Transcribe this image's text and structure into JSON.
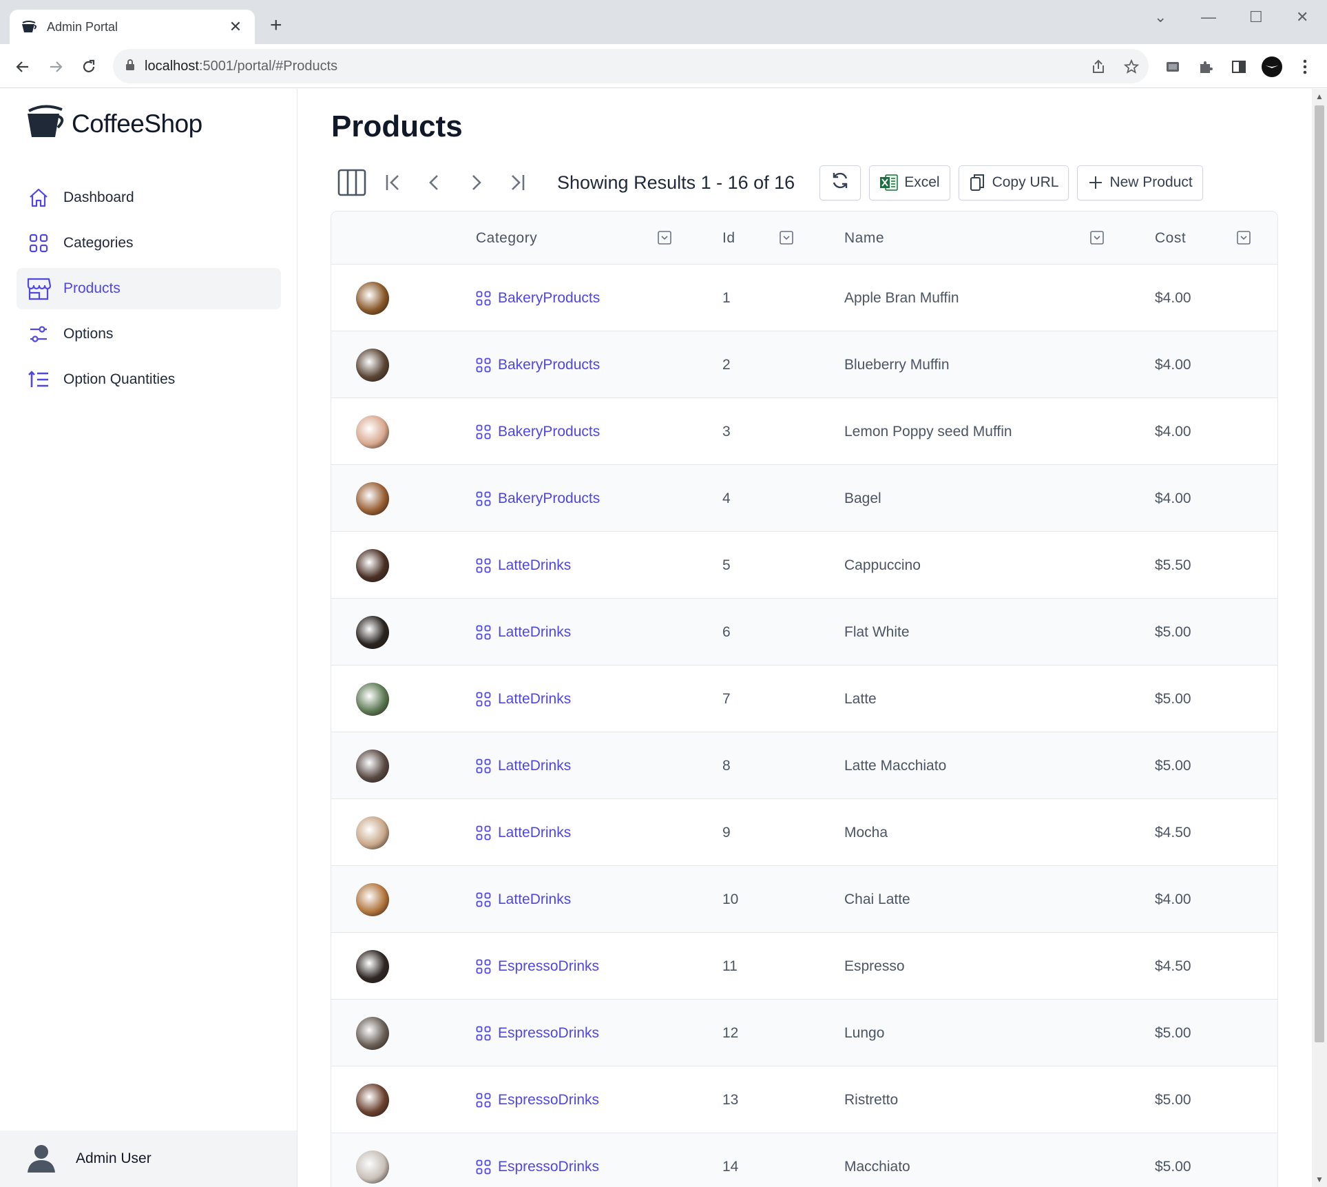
{
  "browser": {
    "tab_title": "Admin Portal",
    "url_host": "localhost",
    "url_path": ":5001/portal/#Products"
  },
  "app": {
    "brand": "CoffeeShop",
    "nav": [
      {
        "label": "Dashboard",
        "icon": "home-icon",
        "active": false
      },
      {
        "label": "Categories",
        "icon": "grid-icon",
        "active": false
      },
      {
        "label": "Products",
        "icon": "store-icon",
        "active": true
      },
      {
        "label": "Options",
        "icon": "sliders-icon",
        "active": false
      },
      {
        "label": "Option Quantities",
        "icon": "list-increase-icon",
        "active": false
      }
    ],
    "user": "Admin User"
  },
  "page": {
    "title": "Products",
    "results_text": "Showing Results 1 - 16 of 16",
    "buttons": {
      "excel": "Excel",
      "copy_url": "Copy URL",
      "new_product": "New Product"
    }
  },
  "table": {
    "columns": [
      "Category",
      "Id",
      "Name",
      "Cost"
    ],
    "rows": [
      {
        "category": "BakeryProducts",
        "id": "1",
        "name": "Apple Bran Muffin",
        "cost": "$4.00",
        "thumb": "#8a5a2b"
      },
      {
        "category": "BakeryProducts",
        "id": "2",
        "name": "Blueberry Muffin",
        "cost": "$4.00",
        "thumb": "#5b4636"
      },
      {
        "category": "BakeryProducts",
        "id": "3",
        "name": "Lemon Poppy seed Muffin",
        "cost": "$4.00",
        "thumb": "#d9a98f"
      },
      {
        "category": "BakeryProducts",
        "id": "4",
        "name": "Bagel",
        "cost": "$4.00",
        "thumb": "#9a6035"
      },
      {
        "category": "LatteDrinks",
        "id": "5",
        "name": "Cappuccino",
        "cost": "$5.50",
        "thumb": "#4a3026"
      },
      {
        "category": "LatteDrinks",
        "id": "6",
        "name": "Flat White",
        "cost": "$5.00",
        "thumb": "#2a2420"
      },
      {
        "category": "LatteDrinks",
        "id": "7",
        "name": "Latte",
        "cost": "$5.00",
        "thumb": "#5e7a55"
      },
      {
        "category": "LatteDrinks",
        "id": "8",
        "name": "Latte Macchiato",
        "cost": "$5.00",
        "thumb": "#5a4a44"
      },
      {
        "category": "LatteDrinks",
        "id": "9",
        "name": "Mocha",
        "cost": "$4.50",
        "thumb": "#c9a88a"
      },
      {
        "category": "LatteDrinks",
        "id": "10",
        "name": "Chai Latte",
        "cost": "$4.00",
        "thumb": "#b3773f"
      },
      {
        "category": "EspressoDrinks",
        "id": "11",
        "name": "Espresso",
        "cost": "$4.50",
        "thumb": "#2f2723"
      },
      {
        "category": "EspressoDrinks",
        "id": "12",
        "name": "Lungo",
        "cost": "$5.00",
        "thumb": "#6a6058"
      },
      {
        "category": "EspressoDrinks",
        "id": "13",
        "name": "Ristretto",
        "cost": "$5.00",
        "thumb": "#6b4230"
      },
      {
        "category": "EspressoDrinks",
        "id": "14",
        "name": "Macchiato",
        "cost": "$5.00",
        "thumb": "#c8c0b8"
      }
    ]
  },
  "colors": {
    "accent": "#4f46e5",
    "excel_green": "#1d6f42"
  }
}
